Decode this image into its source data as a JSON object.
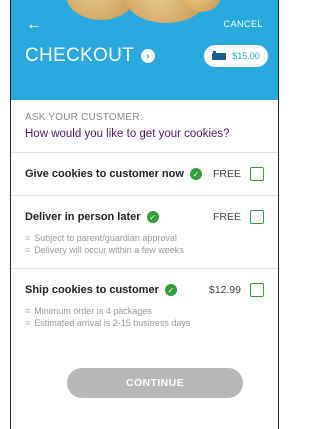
{
  "header": {
    "back_icon": "arrow-left-icon",
    "cancel_label": "CANCEL",
    "title": "CHECKOUT",
    "cart_total": "$15.00",
    "brand_color": "#29a9e0"
  },
  "ask": {
    "label": "ASK YOUR CUSTOMER:",
    "question": "How would you like to get your cookies?"
  },
  "options": [
    {
      "title": "Give cookies to customer now",
      "price": "FREE",
      "notes": []
    },
    {
      "title": "Deliver in person later",
      "price": "FREE",
      "notes": [
        "Subject to parent/guardian approval",
        "Delivery will occur within a few weeks"
      ]
    },
    {
      "title": "Ship cookies to customer",
      "price": "$12.99",
      "notes": [
        "Minimum order is 4 packages",
        "Estimated arrival is 2-15 business days"
      ]
    }
  ],
  "footer": {
    "continue_label": "CONTINUE"
  },
  "colors": {
    "accent_green": "#2e9e3e",
    "question_purple": "#4b1a6b",
    "disabled_button": "#b8b8b8"
  }
}
